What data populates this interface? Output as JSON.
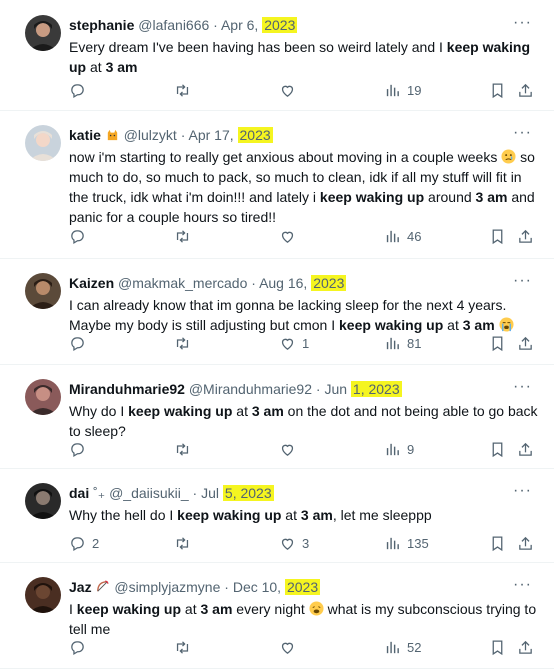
{
  "tweets": [
    {
      "name": "stephanie",
      "handle": "@lafani666",
      "date_pre": "Apr 6, ",
      "date_year": "2023",
      "text": [
        {
          "t": "Every dream I've been having has been so weird lately and I ",
          "b": false
        },
        {
          "t": "keep waking up",
          "b": true
        },
        {
          "t": " at ",
          "b": false
        },
        {
          "t": "3 am",
          "b": true
        }
      ],
      "likes": "",
      "replies": "",
      "views": "19",
      "avatar_color": "#3a3a3a"
    },
    {
      "name": "katie",
      "name_emoji": "cat-emoji",
      "handle": "@lulzykt",
      "date_pre": "Apr 17, ",
      "date_year": "2023",
      "text": [
        {
          "t": "now i'm starting to really get anxious about moving in a couple weeks ",
          "b": false
        },
        {
          "emoji": "crying-face-emoji"
        },
        {
          "t": " so much to do, so much to pack, so much to clean, idk if all my stuff will fit in the truck, idk what i'm doin!!! and lately i ",
          "b": false
        },
        {
          "t": "keep waking up",
          "b": true
        },
        {
          "t": " around ",
          "b": false
        },
        {
          "t": "3 am",
          "b": true
        },
        {
          "t": " and panic for a couple hours so tired!!",
          "b": false
        }
      ],
      "likes": "",
      "replies": "",
      "views": "46",
      "avatar_color": "#c9d3dc"
    },
    {
      "name": "Kaizen",
      "handle": "@makmak_mercado",
      "date_pre": "Aug 16, ",
      "date_year": "2023",
      "text": [
        {
          "t": "I can already know that im gonna be lacking sleep for the next 4 years. Maybe my body is still adjusting but cmon I ",
          "b": false
        },
        {
          "t": "keep waking up",
          "b": true
        },
        {
          "t": " at ",
          "b": false
        },
        {
          "t": "3 am",
          "b": true
        },
        {
          "t": " ",
          "b": false
        },
        {
          "emoji": "loudly-crying-emoji"
        }
      ],
      "likes": "1",
      "replies": "",
      "views": "81",
      "avatar_color": "#5b4a3a"
    },
    {
      "name": "Miranduhmarie92",
      "handle": "@Miranduhmarie92",
      "date_pre": "Jun ",
      "date_year": "1, 2023",
      "text": [
        {
          "t": "Why do I ",
          "b": false
        },
        {
          "t": "keep waking up",
          "b": true
        },
        {
          "t": " at ",
          "b": false
        },
        {
          "t": "3 am",
          "b": true
        },
        {
          "t": " on the dot and not being able to go back to sleep?",
          "b": false
        }
      ],
      "likes": "",
      "replies": "",
      "views": "9",
      "avatar_color": "#8a5a5a"
    },
    {
      "name": "dai",
      "name_suffix": " ˚₊",
      "handle": "@_daiisukii_",
      "date_pre": "Jul ",
      "date_year": "5, 2023",
      "text": [
        {
          "t": "Why the hell do I ",
          "b": false
        },
        {
          "t": "keep waking up",
          "b": true
        },
        {
          "t": " at ",
          "b": false
        },
        {
          "t": "3 am",
          "b": true
        },
        {
          "t": ", let me sleeppp",
          "b": false
        }
      ],
      "likes": "3",
      "replies": "2",
      "views": "135",
      "avatar_color": "#2a2a2a"
    },
    {
      "name": "Jaz",
      "name_emoji": "bow-and-arrow-emoji",
      "handle": "@simplyjazmyne",
      "date_pre": "Dec 10, ",
      "date_year": "2023",
      "text": [
        {
          "t": "I ",
          "b": false
        },
        {
          "t": "keep waking up",
          "b": true
        },
        {
          "t": " at ",
          "b": false
        },
        {
          "t": "3 am",
          "b": true
        },
        {
          "t": " every night ",
          "b": false
        },
        {
          "emoji": "weary-face-emoji"
        },
        {
          "t": " what is my subconscious trying to tell me",
          "b": false
        }
      ],
      "likes": "",
      "replies": "",
      "views": "52",
      "avatar_color": "#4a2e22"
    }
  ],
  "colors": {
    "highlight": "#f5f520",
    "muted": "#536471",
    "text": "#0f1419"
  },
  "icons": [
    "reply-icon",
    "retweet-icon",
    "like-icon",
    "views-icon",
    "bookmark-icon",
    "share-icon",
    "more-icon"
  ]
}
